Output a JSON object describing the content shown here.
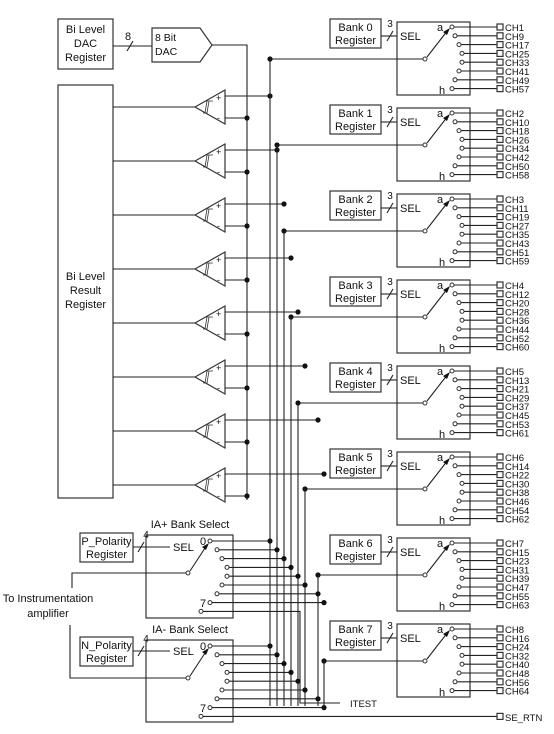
{
  "dac_register": {
    "lines": [
      "Bi Level",
      "DAC",
      "Register"
    ]
  },
  "dac_bus_width": "8",
  "dac": {
    "lines": [
      "8 Bit",
      "DAC"
    ]
  },
  "result_register": {
    "lines": [
      "Bi Level",
      "Result",
      "Register"
    ]
  },
  "comparator_count": 8,
  "banks": [
    {
      "lines": [
        "Bank 0",
        "Register"
      ],
      "bus_width": "3",
      "sel": "SEL",
      "first": "a",
      "last": "h",
      "channels": [
        "CH1",
        "CH9",
        "CH17",
        "CH25",
        "CH33",
        "CH41",
        "CH49",
        "CH57"
      ]
    },
    {
      "lines": [
        "Bank 1",
        "Register"
      ],
      "bus_width": "3",
      "sel": "SEL",
      "first": "a",
      "last": "h",
      "channels": [
        "CH2",
        "CH10",
        "CH18",
        "CH26",
        "CH34",
        "CH42",
        "CH50",
        "CH58"
      ]
    },
    {
      "lines": [
        "Bank 2",
        "Register"
      ],
      "bus_width": "3",
      "sel": "SEL",
      "first": "a",
      "last": "h",
      "channels": [
        "CH3",
        "CH11",
        "CH19",
        "CH27",
        "CH35",
        "CH43",
        "CH51",
        "CH59"
      ]
    },
    {
      "lines": [
        "Bank 3",
        "Register"
      ],
      "bus_width": "3",
      "sel": "SEL",
      "first": "a",
      "last": "h",
      "channels": [
        "CH4",
        "CH12",
        "CH20",
        "CH28",
        "CH36",
        "CH44",
        "CH52",
        "CH60"
      ]
    },
    {
      "lines": [
        "Bank 4",
        "Register"
      ],
      "bus_width": "3",
      "sel": "SEL",
      "first": "a",
      "last": "h",
      "channels": [
        "CH5",
        "CH13",
        "CH21",
        "CH29",
        "CH37",
        "CH45",
        "CH53",
        "CH61"
      ]
    },
    {
      "lines": [
        "Bank 5",
        "Register"
      ],
      "bus_width": "3",
      "sel": "SEL",
      "first": "a",
      "last": "h",
      "channels": [
        "CH6",
        "CH14",
        "CH22",
        "CH30",
        "CH38",
        "CH46",
        "CH54",
        "CH62"
      ]
    },
    {
      "lines": [
        "Bank 6",
        "Register"
      ],
      "bus_width": "3",
      "sel": "SEL",
      "first": "a",
      "last": "h",
      "channels": [
        "CH7",
        "CH15",
        "CH23",
        "CH31",
        "CH39",
        "CH47",
        "CH55",
        "CH63"
      ]
    },
    {
      "lines": [
        "Bank 7",
        "Register"
      ],
      "bus_width": "3",
      "sel": "SEL",
      "first": "a",
      "last": "h",
      "channels": [
        "CH8",
        "CH16",
        "CH24",
        "CH32",
        "CH40",
        "CH48",
        "CH56",
        "CH64"
      ]
    }
  ],
  "ia_plus": {
    "title": "IA+ Bank Select",
    "register": [
      "P_Polarity",
      "Register"
    ],
    "bus_width": "4",
    "sel": "SEL",
    "first": "0",
    "last": "7"
  },
  "ia_minus": {
    "title": "IA- Bank Select",
    "register": [
      "N_Polarity",
      "Register"
    ],
    "bus_width": "4",
    "sel": "SEL",
    "first": "0",
    "last": "7"
  },
  "output_label": [
    "To Instrumentation",
    "amplifier"
  ],
  "itest_label": "ITEST",
  "se_rtn_label": "SE_RTN"
}
